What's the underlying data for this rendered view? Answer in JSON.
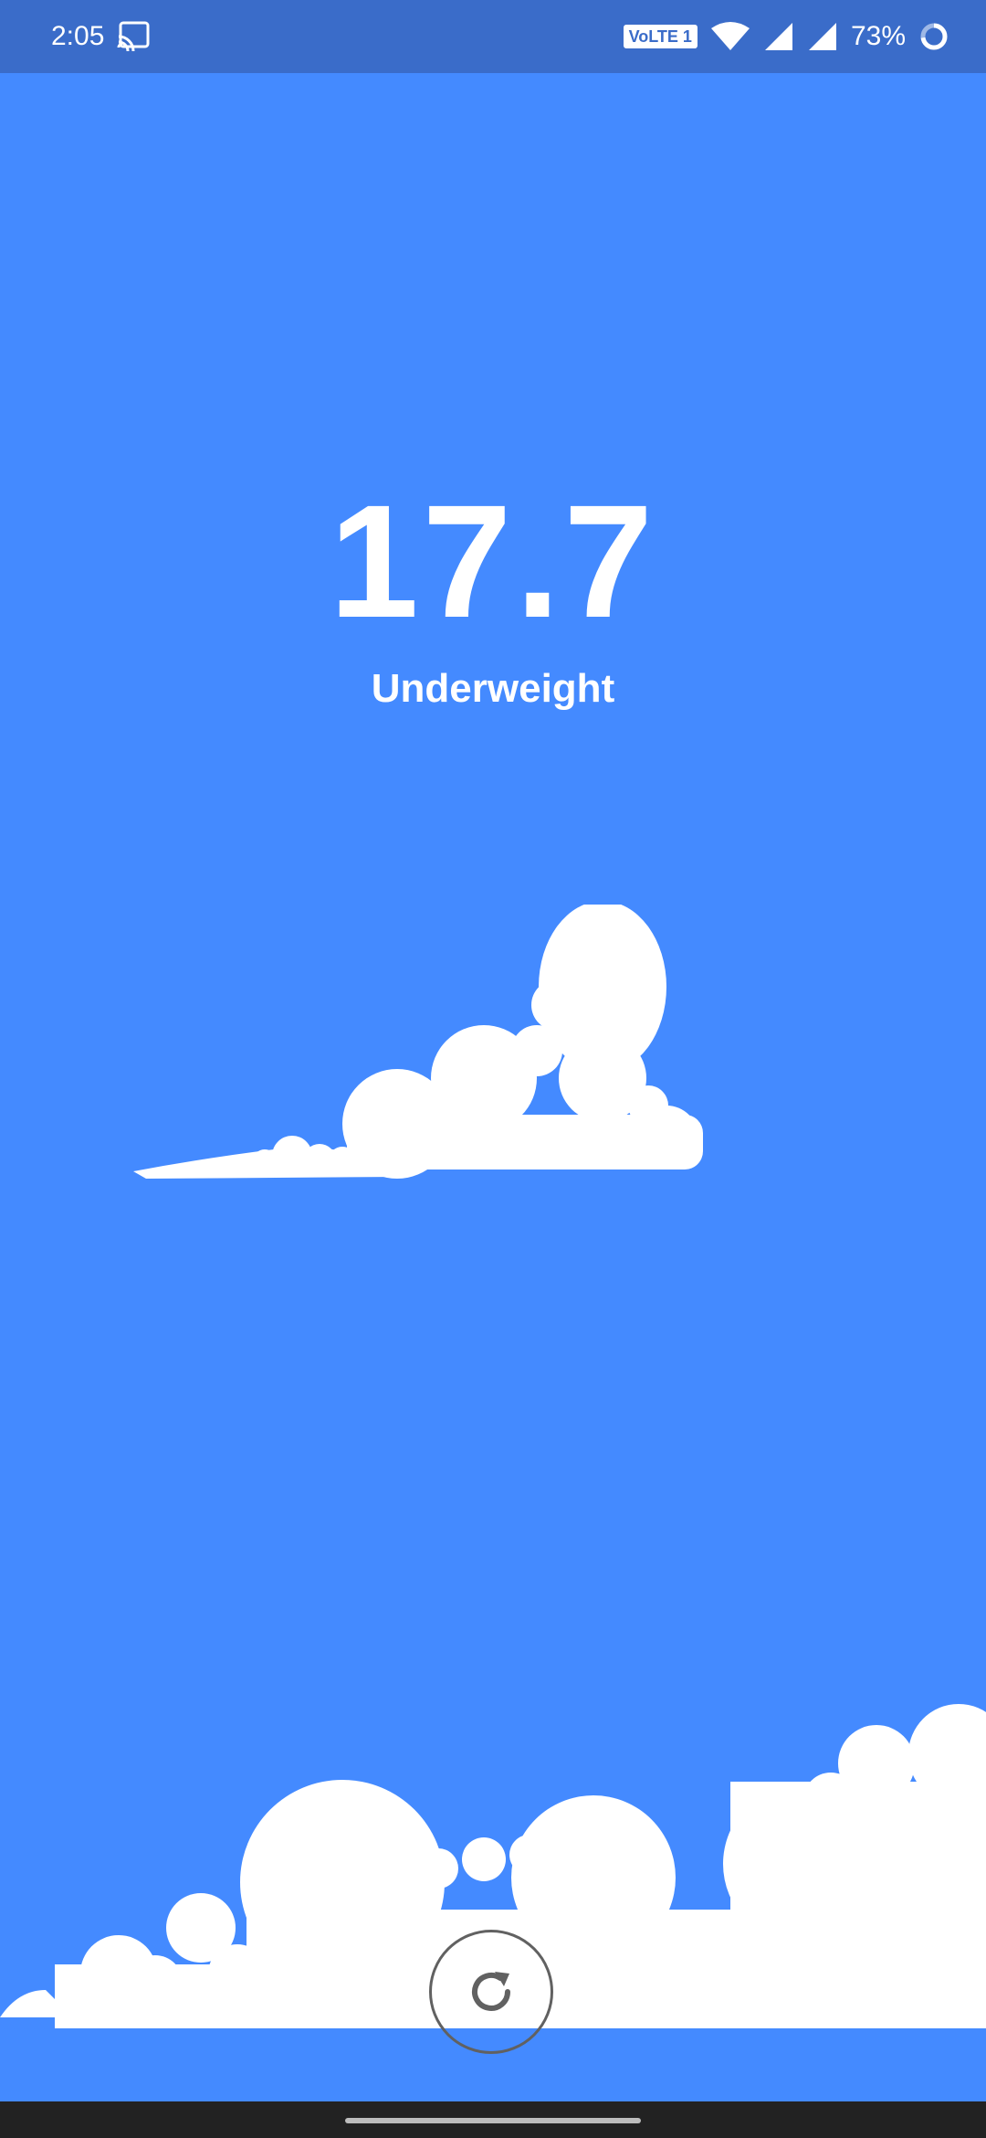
{
  "status_bar": {
    "time": "2:05",
    "network_badge": "VoLTE 1",
    "battery": "73%",
    "icons": [
      "cast-icon",
      "wifi-icon",
      "signal-icon",
      "signal-icon",
      "battery-ring-icon"
    ]
  },
  "result": {
    "bmi_value": "17.7",
    "category": "Underweight"
  },
  "controls": {
    "refresh_icon": "refresh-icon"
  },
  "colors": {
    "background": "#448AFF",
    "status_bar": "#3A6CC9",
    "text": "#FFFFFF",
    "cloud": "#FFFFFF",
    "refresh_border": "#616161",
    "nav_bar": "#222222"
  }
}
